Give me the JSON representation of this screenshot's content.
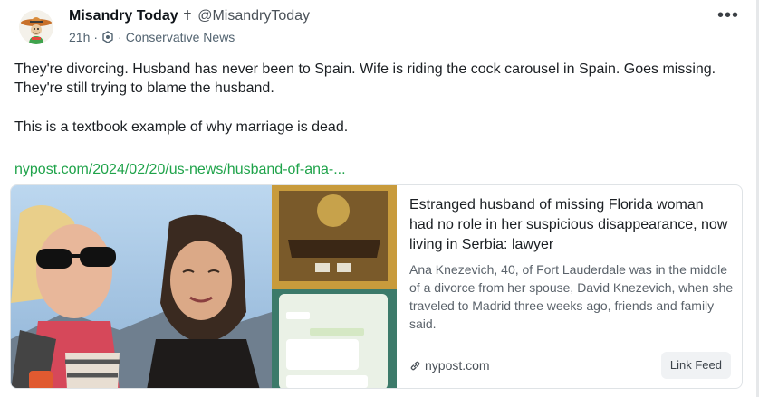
{
  "author": {
    "display_name": "Misandry Today",
    "badge_glyph": "✝",
    "handle": "@MisandryToday",
    "avatar_icon": "sombrero-cartoon-avatar"
  },
  "meta": {
    "time": "21h",
    "separator": "·",
    "community_icon": "community-icon",
    "community": "Conservative News"
  },
  "more_glyph": "•••",
  "post": {
    "paragraph1": "They're divorcing. Husband has never been to Spain. Wife is riding the cock carousel in Spain. Goes missing. They're still trying to blame the husband.",
    "paragraph2": "This is a textbook example of why marriage is dead.",
    "link_text": "nypost.com/2024/02/20/us-news/husband-of-ana-..."
  },
  "card": {
    "title": "Estranged husband of missing Florida woman had no role in her suspicious disappearance, now living in Serbia: lawyer",
    "description": "Ana Knezevich, 40, of Fort Lauderdale was in the middle of a divorce from her spouse, David Knezevich, when she traveled to Madrid three weeks ago, friends and family said.",
    "domain": "nypost.com",
    "domain_icon": "link-icon",
    "button_label": "Link Feed"
  },
  "colors": {
    "link_green": "#1fa34a",
    "muted_text": "#536471",
    "card_border": "#dfe3e6"
  }
}
